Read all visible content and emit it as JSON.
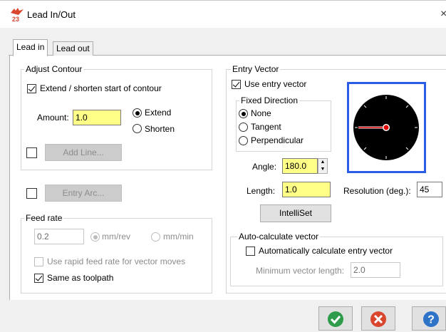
{
  "window": {
    "title": "Lead In/Out",
    "close_glyph": "×"
  },
  "tabs": [
    {
      "label": "Lead in",
      "active": true
    },
    {
      "label": "Lead out",
      "active": false
    }
  ],
  "adjust_contour": {
    "title": "Adjust Contour",
    "extend_checkbox_label": "Extend / shorten start of contour",
    "extend_checked": true,
    "amount_label": "Amount:",
    "amount_value": "1.0",
    "extend_label": "Extend",
    "shorten_label": "Shorten",
    "mode": "Extend",
    "add_line_label": "Add Line..."
  },
  "entry_arc": {
    "label": "Entry Arc...",
    "checked": false
  },
  "feed_rate": {
    "title": "Feed rate",
    "value": "0.2",
    "unit_mmrev": "mm/rev",
    "unit_mmmin": "mm/min",
    "unit_selected": "mm/rev",
    "rapid_label": "Use rapid feed rate for vector moves",
    "rapid_checked": false,
    "same_label": "Same as toolpath",
    "same_checked": true
  },
  "entry_vector": {
    "title": "Entry Vector",
    "use_label": "Use entry vector",
    "use_checked": true,
    "fixed_title": "Fixed Direction",
    "opt_none": "None",
    "opt_tangent": "Tangent",
    "opt_perp": "Perpendicular",
    "fixed_selected": "None",
    "angle_label": "Angle:",
    "angle_value": "180.0",
    "length_label": "Length:",
    "length_value": "1.0",
    "resolution_label": "Resolution (deg.):",
    "resolution_value": "45",
    "intelliset_label": "IntelliSet",
    "dial_angle_deg": 180
  },
  "auto_calc": {
    "title": "Auto-calculate vector",
    "auto_label": "Automatically calculate entry vector",
    "auto_checked": false,
    "minlen_label": "Minimum vector length:",
    "minlen_value": "2.0"
  },
  "buttons": {
    "ok_icon": "ok-icon",
    "cancel_icon": "cancel-icon",
    "help_icon": "help-icon",
    "help_glyph": "?"
  },
  "colors": {
    "ok": "#2e9c4a",
    "cancel": "#d9452d",
    "help": "#2f73c9",
    "dial_frame": "#2b5ce6",
    "dial_arrow": "#e00000",
    "input_highlight": "#ffff88"
  }
}
